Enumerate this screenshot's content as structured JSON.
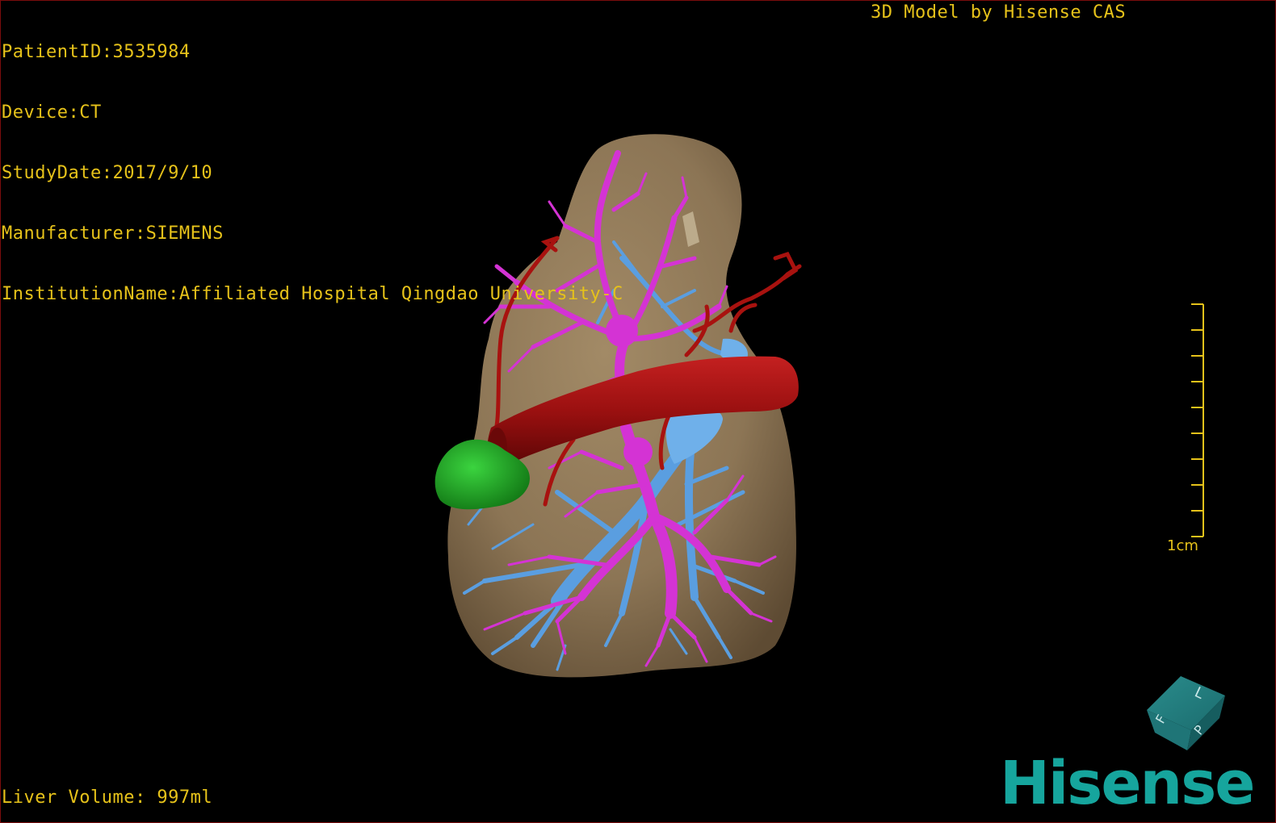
{
  "overlay": {
    "patient_id": "PatientID:3535984",
    "device": "Device:CT",
    "study_date": "StudyDate:2017/9/10",
    "manufacturer": "Manufacturer:SIEMENS",
    "institution": "InstitutionName:Affiliated Hospital Qingdao University-C",
    "header_right": "3D Model by Hisense CAS",
    "liver_volume": "Liver Volume: 997ml"
  },
  "scale_bar": {
    "label": "1cm"
  },
  "orientation_cube": {
    "faces": [
      "F",
      "L",
      "P"
    ]
  },
  "brand": {
    "logo_text": "Hisense"
  },
  "colors": {
    "overlay_text": "#e6c21a",
    "liver": "#8c7555",
    "portal_vein": "#d433d4",
    "hepatic_vein": "#5a9ee0",
    "hepatic_artery": "#b01515",
    "gallbladder": "#1fae24",
    "brand": "#16a59d"
  }
}
